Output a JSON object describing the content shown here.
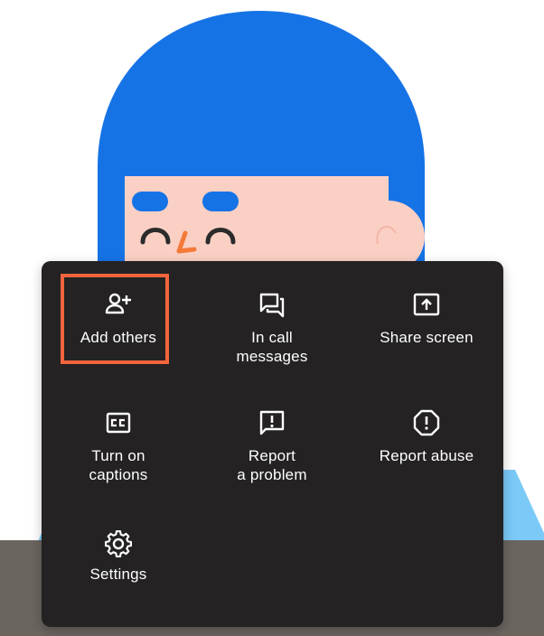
{
  "menu": {
    "items": [
      {
        "id": "add-others",
        "label": "Add others",
        "icon": "person-add-icon"
      },
      {
        "id": "in-call-messages",
        "label": "In call\nmessages",
        "icon": "chat-icon"
      },
      {
        "id": "share-screen",
        "label": "Share screen",
        "icon": "present-screen-icon"
      },
      {
        "id": "turn-on-captions",
        "label": "Turn on\ncaptions",
        "icon": "closed-captions-icon"
      },
      {
        "id": "report-a-problem",
        "label": "Report\na problem",
        "icon": "feedback-icon"
      },
      {
        "id": "report-abuse",
        "label": "Report abuse",
        "icon": "report-icon"
      },
      {
        "id": "settings",
        "label": "Settings",
        "icon": "gear-icon"
      }
    ]
  },
  "colors": {
    "menu_background": "#242223",
    "highlight": "#f2643c",
    "hair": "#1673e6",
    "skin": "#fbd0c4",
    "shirt": "#7bc9f7"
  }
}
